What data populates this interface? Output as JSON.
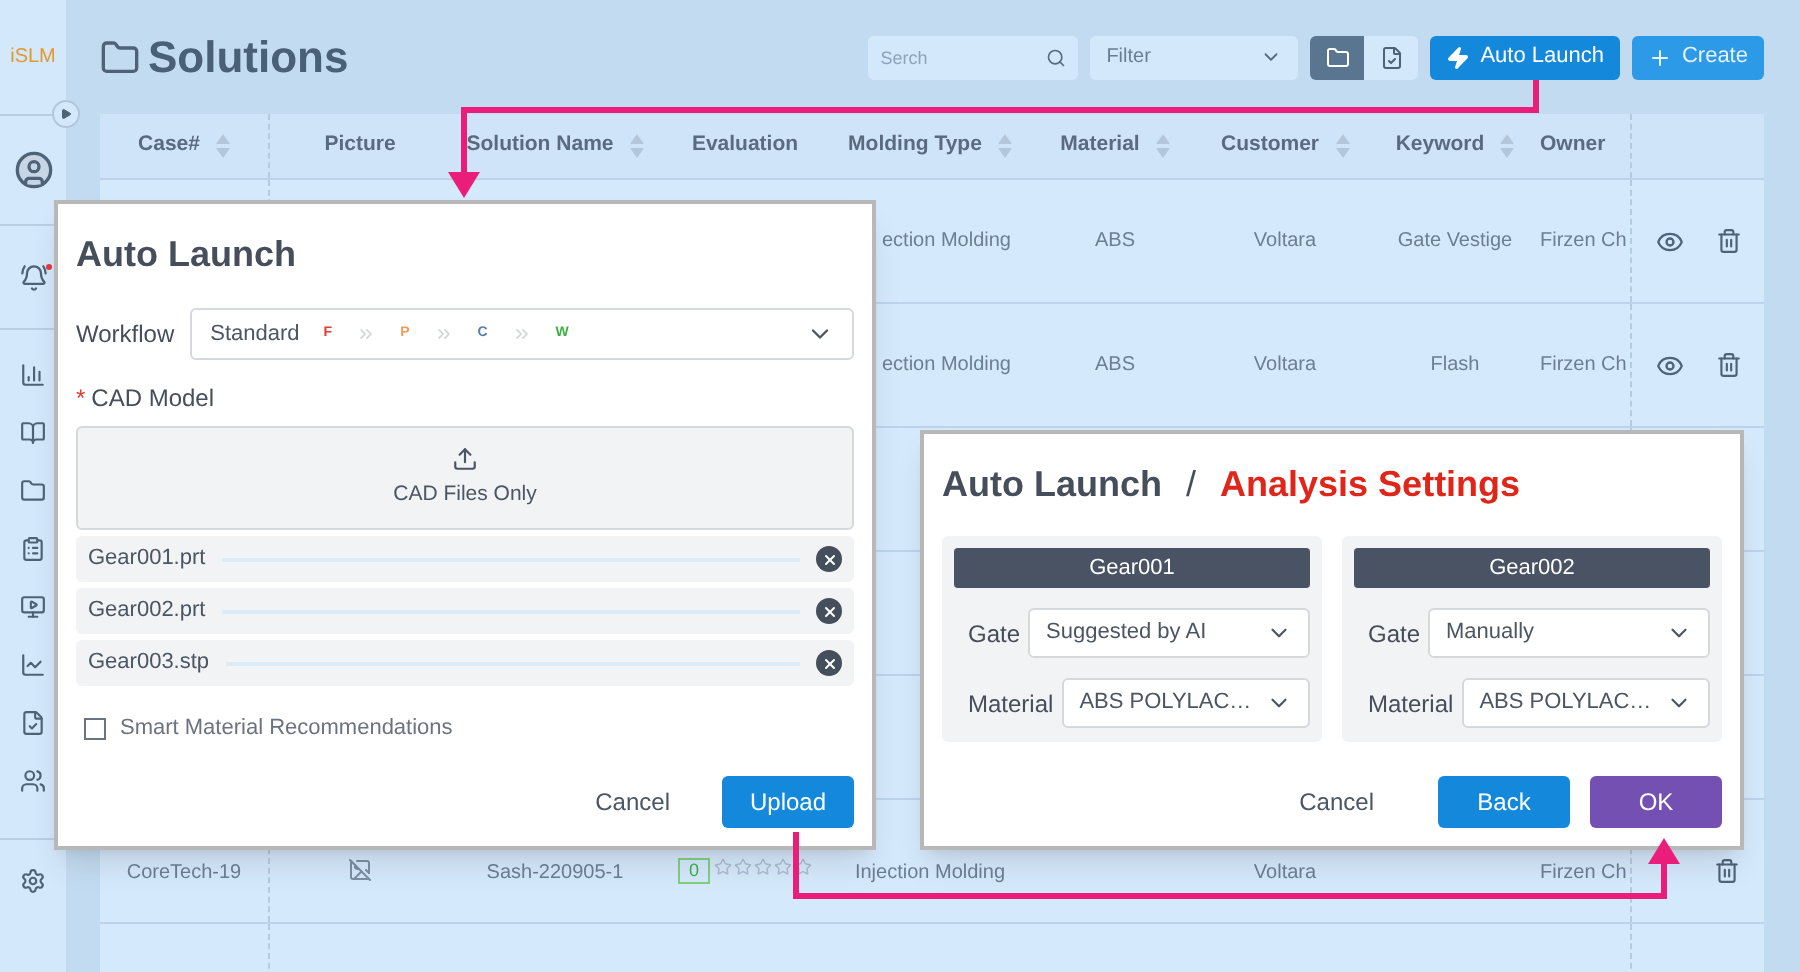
{
  "sidebar": {
    "logo": "iSLM",
    "alert_dot": true
  },
  "page": {
    "title": "Solutions"
  },
  "toolbar": {
    "search": {
      "placeholder": "Serch"
    },
    "filter": {
      "placeholder": "Filter"
    },
    "view_toggle": [
      {
        "selected": true
      },
      {
        "selected": false
      }
    ],
    "auto_launch": "Auto Launch",
    "create": "Create"
  },
  "table": {
    "columns": [
      {
        "label": "Case#",
        "sortable": true
      },
      {
        "label": "Picture",
        "sortable": false
      },
      {
        "label": "Solution Name",
        "sortable": true
      },
      {
        "label": "Evaluation",
        "sortable": false
      },
      {
        "label": "Molding Type",
        "sortable": true
      },
      {
        "label": "Material",
        "sortable": true
      },
      {
        "label": "Customer",
        "sortable": true
      },
      {
        "label": "Keyword",
        "sortable": true
      },
      {
        "label": "Owner",
        "sortable": false
      }
    ],
    "rows": [
      {
        "kind": "top",
        "molding_type": "ection Molding",
        "material": "ABS",
        "customer": "Voltara",
        "keyword": "Gate Vestige",
        "owner": "Firzen Ch"
      },
      {
        "kind": "top",
        "molding_type": "ection Molding",
        "material": "ABS",
        "customer": "Voltara",
        "keyword": "Flash",
        "owner": "Firzen Ch"
      },
      {
        "kind": "covered"
      },
      {
        "kind": "covered"
      },
      {
        "kind": "covered"
      },
      {
        "kind": "bottom",
        "case": "CoreTech-19",
        "solution_name": "Sash-220905-1",
        "score": "0",
        "stars": 0,
        "molding_type": "Injection Molding",
        "customer": "Voltara",
        "owner": "Firzen Ch"
      },
      {
        "kind": "covered"
      }
    ]
  },
  "auto_launch_dialog": {
    "title": "Auto Launch",
    "workflow": {
      "label": "Workflow",
      "value": "Standard",
      "steps": [
        {
          "label": "F",
          "color": "#e53935"
        },
        {
          "label": "P",
          "color": "#f39a5a"
        },
        {
          "label": "C",
          "color": "#5b7fa6"
        },
        {
          "label": "W",
          "color": "#3cb043"
        }
      ]
    },
    "cad_model": {
      "required_mark": "*",
      "label": "CAD Model",
      "dropzone": "CAD Files Only"
    },
    "files": [
      "Gear001.prt",
      "Gear002.prt",
      "Gear003.stp"
    ],
    "smart_material": {
      "label": "Smart Material Recommendations",
      "checked": false
    },
    "buttons": {
      "cancel": "Cancel",
      "upload": "Upload"
    }
  },
  "analysis_dialog": {
    "title": "Auto Launch",
    "separator": "/",
    "subtitle": "Analysis Settings",
    "parts": [
      {
        "name": "Gear001",
        "gate_label": "Gate",
        "gate": "Suggested by AI",
        "material_label": "Material",
        "material": "ABS POLYLAC…"
      },
      {
        "name": "Gear002",
        "gate_label": "Gate",
        "gate": "Manually",
        "material_label": "Material",
        "material": "ABS POLYLAC…"
      }
    ],
    "buttons": {
      "cancel": "Cancel",
      "back": "Back",
      "ok": "OK"
    }
  }
}
